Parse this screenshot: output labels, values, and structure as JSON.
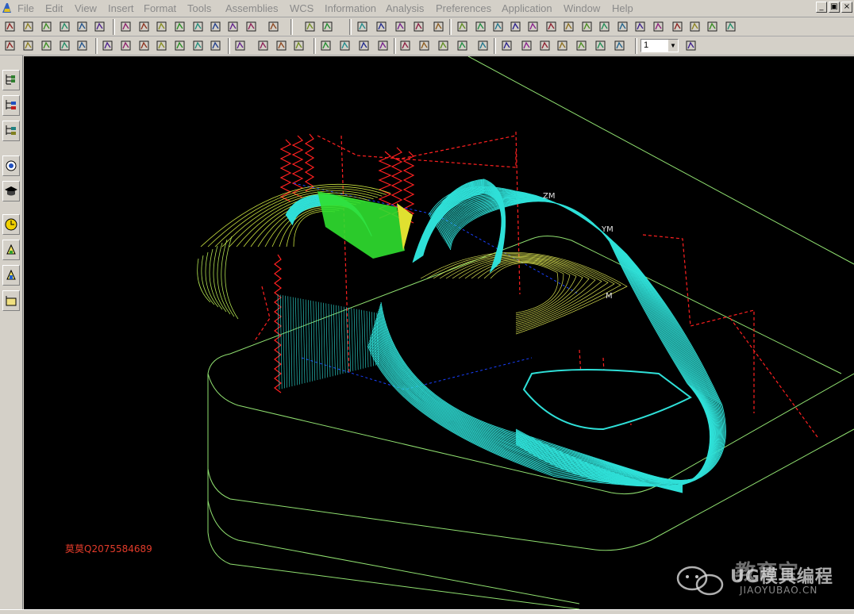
{
  "menubar": {
    "items": [
      "File",
      "Edit",
      "View",
      "Insert",
      "Format",
      "Tools",
      "Assemblies",
      "WCS",
      "Information",
      "Analysis",
      "Preferences",
      "Application",
      "Window",
      "Help"
    ],
    "mnemonics": [
      "F",
      "E",
      "V",
      "I",
      "o",
      "T",
      "A",
      "W",
      "I",
      "y",
      "P",
      "t",
      "W",
      "H"
    ]
  },
  "window_buttons": {
    "restore": "_",
    "maximize": "▣",
    "close": "×"
  },
  "toolbar": {
    "layer_value": "1"
  },
  "viewport": {
    "axis_zm": "ZM",
    "axis_ym": "YM",
    "axis_xm": "M",
    "watermark": "莫莫Q2075584689",
    "brand_cn": "教育宝",
    "brand_overlay": "UG模具编程",
    "brand_en": "JIAOYUBAO.CN"
  },
  "colors": {
    "toolpath": "#2fe0d8",
    "rapid": "#ff2020",
    "engage": "#1840ff",
    "highlight": "#30e030",
    "blank": "#90e070",
    "background": "#000000"
  }
}
